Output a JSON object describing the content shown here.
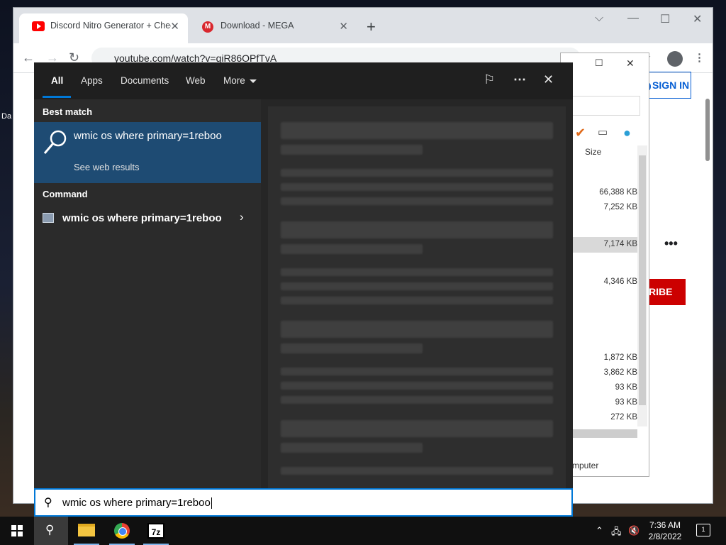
{
  "desktop": {
    "icon_label": "Da"
  },
  "browser": {
    "tabs": [
      {
        "title": "Discord Nitro Generator + Check",
        "icon": "youtube-icon",
        "active": true
      },
      {
        "title": "Download - MEGA",
        "icon": "mega-icon",
        "icon_text": "M",
        "active": false
      }
    ],
    "new_tab": "+",
    "url": "youtube.com/watch?v=qiR86OPfTvA",
    "sign_in_label": "SIGN IN",
    "sign_in_icon_text": "?",
    "subscribe_label": "RIBE",
    "more_label": "•••"
  },
  "sevenzip": {
    "size_header": "Size",
    "rows": [
      "66,388 KB",
      "7,252 KB",
      "7,174 KB",
      "4,346 KB",
      "1,872 KB",
      "3,862 KB",
      "93 KB",
      "93 KB",
      "272 KB"
    ],
    "status": "mputer"
  },
  "search": {
    "filters": [
      {
        "label": "All",
        "active": true
      },
      {
        "label": "Apps"
      },
      {
        "label": "Documents"
      },
      {
        "label": "Web"
      },
      {
        "label": "More"
      }
    ],
    "best_match_heading": "Best match",
    "best_match": {
      "title": "wmic os where primary=1reboo",
      "subtitle": "See web results"
    },
    "command_heading": "Command",
    "command": {
      "label": "wmic os where primary=1reboo"
    },
    "query": "wmic os where primary=1reboo"
  },
  "taskbar": {
    "apps": [
      "start-button",
      "search-button",
      "file-explorer",
      "chrome",
      "7-zip"
    ],
    "zip_label": "7z",
    "time": "7:36 AM",
    "date": "2/8/2022",
    "notification_count": "1"
  },
  "colors": {
    "accent": "#0078d7",
    "best_match_bg": "#1e4b73",
    "youtube_red": "#cc0000"
  }
}
